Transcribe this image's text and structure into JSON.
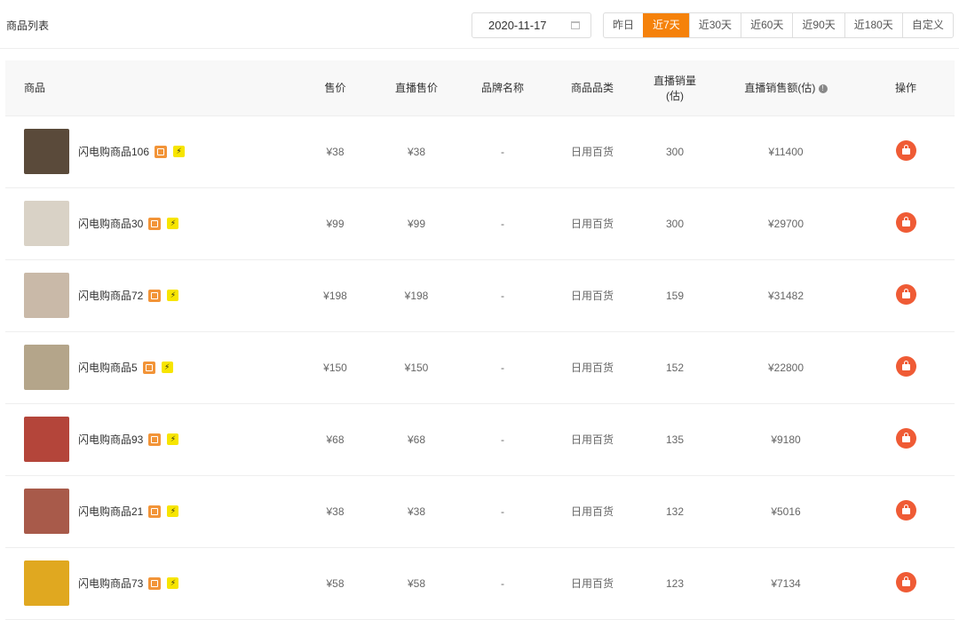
{
  "header": {
    "title": "商品列表",
    "date": "2020-11-17",
    "ranges": [
      "昨日",
      "近7天",
      "近30天",
      "近60天",
      "近90天",
      "近180天",
      "自定义"
    ],
    "active_range": 1
  },
  "columns": [
    "商品",
    "售价",
    "直播售价",
    "品牌名称",
    "商品品类",
    "直播销量",
    "(估)",
    "直播销售额(估)",
    "操作"
  ],
  "info_glyph": "!",
  "badge_glyph": "⚡",
  "colors": {
    "accent": "#f5820b",
    "action": "#ef5b35"
  },
  "rows": [
    {
      "name": "闪电购商品106",
      "price": "¥38",
      "live_price": "¥38",
      "brand": "-",
      "category": "日用百货",
      "sales": "300",
      "revenue": "¥11400",
      "thumb": "#5a4a3a"
    },
    {
      "name": "闪电购商品30",
      "price": "¥99",
      "live_price": "¥99",
      "brand": "-",
      "category": "日用百货",
      "sales": "300",
      "revenue": "¥29700",
      "thumb": "#d9d2c6"
    },
    {
      "name": "闪电购商品72",
      "price": "¥198",
      "live_price": "¥198",
      "brand": "-",
      "category": "日用百货",
      "sales": "159",
      "revenue": "¥31482",
      "thumb": "#c9b9a8"
    },
    {
      "name": "闪电购商品5",
      "price": "¥150",
      "live_price": "¥150",
      "brand": "-",
      "category": "日用百货",
      "sales": "152",
      "revenue": "¥22800",
      "thumb": "#b4a58a"
    },
    {
      "name": "闪电购商品93",
      "price": "¥68",
      "live_price": "¥68",
      "brand": "-",
      "category": "日用百货",
      "sales": "135",
      "revenue": "¥9180",
      "thumb": "#b4453a"
    },
    {
      "name": "闪电购商品21",
      "price": "¥38",
      "live_price": "¥38",
      "brand": "-",
      "category": "日用百货",
      "sales": "132",
      "revenue": "¥5016",
      "thumb": "#a85a4a"
    },
    {
      "name": "闪电购商品73",
      "price": "¥58",
      "live_price": "¥58",
      "brand": "-",
      "category": "日用百货",
      "sales": "123",
      "revenue": "¥7134",
      "thumb": "#e0a820"
    }
  ]
}
